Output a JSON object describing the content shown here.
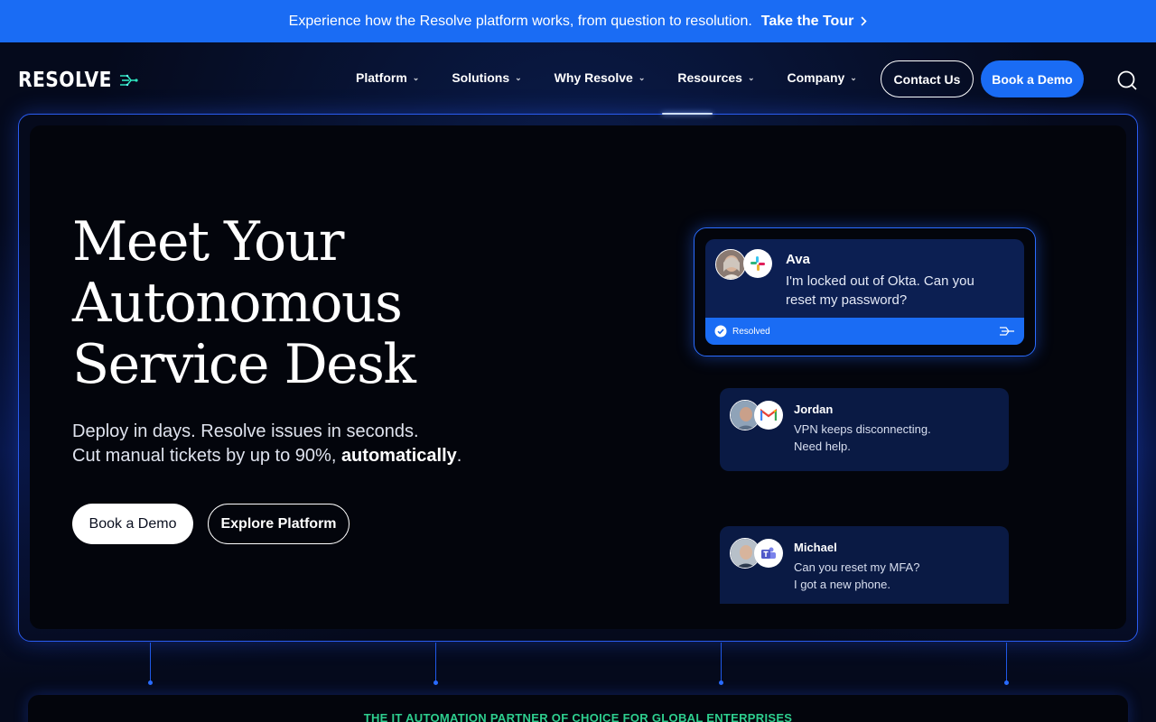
{
  "banner": {
    "text": "Experience how the Resolve platform works, from question to resolution.",
    "cta": "Take the Tour"
  },
  "nav": {
    "logo": "RESOLVE",
    "items": [
      {
        "label": "Platform"
      },
      {
        "label": "Solutions"
      },
      {
        "label": "Why Resolve"
      },
      {
        "label": "Resources"
      },
      {
        "label": "Company"
      }
    ],
    "contact_label": "Contact Us",
    "demo_label": "Book a Demo"
  },
  "hero": {
    "title_lines": [
      "Meet Your",
      "Autonomous",
      "Service Desk"
    ],
    "sub_line1": "Deploy in days. Resolve issues in seconds.",
    "sub_line2_pre": "Cut manual tickets by up to 90%, ",
    "sub_line2_bold": "automatically",
    "sub_line2_post": ".",
    "primary_cta": "Book a Demo",
    "secondary_cta": "Explore Platform"
  },
  "chats": [
    {
      "name": "Ava",
      "line1": "I'm locked out of Okta. Can you",
      "line2": "reset my password?",
      "app": "slack-icon",
      "status": "Resolved"
    },
    {
      "name": "Jordan",
      "line1": "VPN keeps disconnecting.",
      "line2": "Need help.",
      "app": "gmail-icon"
    },
    {
      "name": "Michael",
      "line1": "Can you reset my MFA?",
      "line2": "I got a new phone.",
      "app": "teams-icon"
    }
  ],
  "bottom": {
    "tagline": "THE IT AUTOMATION PARTNER OF CHOICE FOR GLOBAL ENTERPRISES"
  },
  "colors": {
    "accent": "#1a6cf4",
    "background": "#050a1c",
    "tagline": "#2ecf8f"
  }
}
